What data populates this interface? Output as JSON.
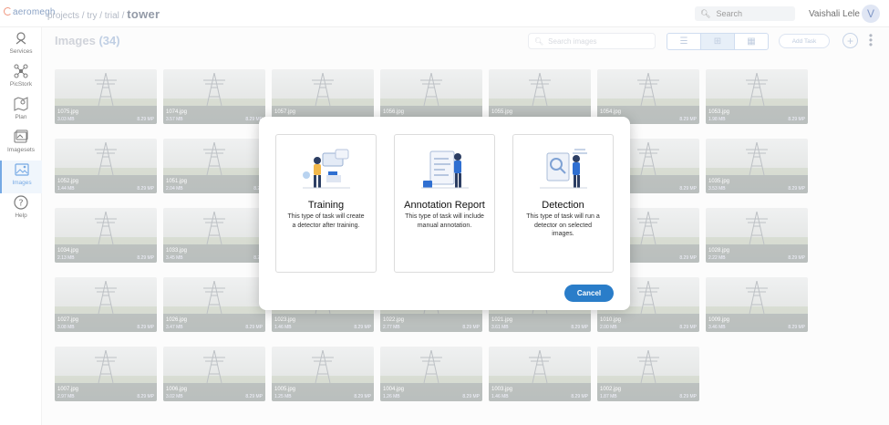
{
  "app": {
    "logo_text": "aeromegh"
  },
  "breadcrumb": {
    "path": "projects / try / trial / ",
    "current": "tower"
  },
  "top_search": {
    "placeholder": "Search"
  },
  "user": {
    "name": "Vaishali Lele",
    "initial": "V"
  },
  "sidebar": {
    "items": [
      {
        "label": "Services",
        "icon": "services-icon",
        "active": false
      },
      {
        "label": "PicStork",
        "icon": "drone-icon",
        "active": false
      },
      {
        "label": "Plan",
        "icon": "map-pin-icon",
        "active": false
      },
      {
        "label": "Imagesets",
        "icon": "imagesets-icon",
        "active": false
      },
      {
        "label": "Images",
        "icon": "image-icon",
        "active": true
      },
      {
        "label": "Help",
        "icon": "help-icon",
        "active": false
      }
    ]
  },
  "page": {
    "title": "Images",
    "count": "(34)"
  },
  "image_search": {
    "placeholder": "Search images"
  },
  "toolbar": {
    "add_task_label": "Add Task",
    "plus": "+"
  },
  "images": [
    {
      "name": "1075.jpg",
      "size": "3.03 MB",
      "mp": "8.29 MP"
    },
    {
      "name": "1074.jpg",
      "size": "3.57 MB",
      "mp": "8.29 MP"
    },
    {
      "name": "1057.jpg",
      "size": "",
      "mp": ""
    },
    {
      "name": "1056.jpg",
      "size": "",
      "mp": ""
    },
    {
      "name": "1055.jpg",
      "size": "",
      "mp": ""
    },
    {
      "name": "1054.jpg",
      "size": "",
      "mp": "8.29 MP"
    },
    {
      "name": "1053.jpg",
      "size": "1.98 MB",
      "mp": "8.29 MP"
    },
    {
      "name": "1052.jpg",
      "size": "1.44 MB",
      "mp": "8.29 MP"
    },
    {
      "name": "1051.jpg",
      "size": "2.04 MB",
      "mp": "8.29"
    },
    {
      "name": "",
      "size": "",
      "mp": ""
    },
    {
      "name": "",
      "size": "",
      "mp": ""
    },
    {
      "name": "",
      "size": "",
      "mp": ""
    },
    {
      "name": "",
      "size": "",
      "mp": "8.29 MP"
    },
    {
      "name": "1035.jpg",
      "size": "3.53 MB",
      "mp": "8.29 MP"
    },
    {
      "name": "1034.jpg",
      "size": "2.13 MB",
      "mp": "8.29 MP"
    },
    {
      "name": "1033.jpg",
      "size": "3.45 MB",
      "mp": "8.29"
    },
    {
      "name": "",
      "size": "",
      "mp": ""
    },
    {
      "name": "",
      "size": "",
      "mp": ""
    },
    {
      "name": "",
      "size": "",
      "mp": ""
    },
    {
      "name": "",
      "size": "",
      "mp": "8.29 MP"
    },
    {
      "name": "1028.jpg",
      "size": "2.22 MB",
      "mp": "8.29 MP"
    },
    {
      "name": "1027.jpg",
      "size": "3.08 MB",
      "mp": "8.29 MP"
    },
    {
      "name": "1026.jpg",
      "size": "3.47 MB",
      "mp": "8.29 MP"
    },
    {
      "name": "1023.jpg",
      "size": "1.46 MB",
      "mp": "8.29 MP"
    },
    {
      "name": "1022.jpg",
      "size": "2.77 MB",
      "mp": "8.29 MP"
    },
    {
      "name": "1021.jpg",
      "size": "3.61 MB",
      "mp": "8.29 MP"
    },
    {
      "name": "1010.jpg",
      "size": "2.00 MB",
      "mp": "8.29 MP"
    },
    {
      "name": "1009.jpg",
      "size": "3.46 MB",
      "mp": "8.29 MP"
    },
    {
      "name": "1007.jpg",
      "size": "2.97 MB",
      "mp": "8.29 MP"
    },
    {
      "name": "1006.jpg",
      "size": "3.02 MB",
      "mp": "8.29 MP"
    },
    {
      "name": "1005.jpg",
      "size": "1.25 MB",
      "mp": "8.29 MP"
    },
    {
      "name": "1004.jpg",
      "size": "1.26 MB",
      "mp": "8.29 MP"
    },
    {
      "name": "1003.jpg",
      "size": "1.46 MB",
      "mp": "8.29 MP"
    },
    {
      "name": "1002.jpg",
      "size": "1.87 MB",
      "mp": "8.29 MP"
    }
  ],
  "modal": {
    "cards": [
      {
        "title": "Training",
        "desc": "This type of task will create a detector after training."
      },
      {
        "title": "Annotation Report",
        "desc": "This type of task will include manual annotation."
      },
      {
        "title": "Detection",
        "desc": "This type of task will run a detector on selected images."
      }
    ],
    "cancel_label": "Cancel"
  },
  "colors": {
    "accent": "#2a7dc9",
    "sidebar_active": "#2b7bd6"
  }
}
